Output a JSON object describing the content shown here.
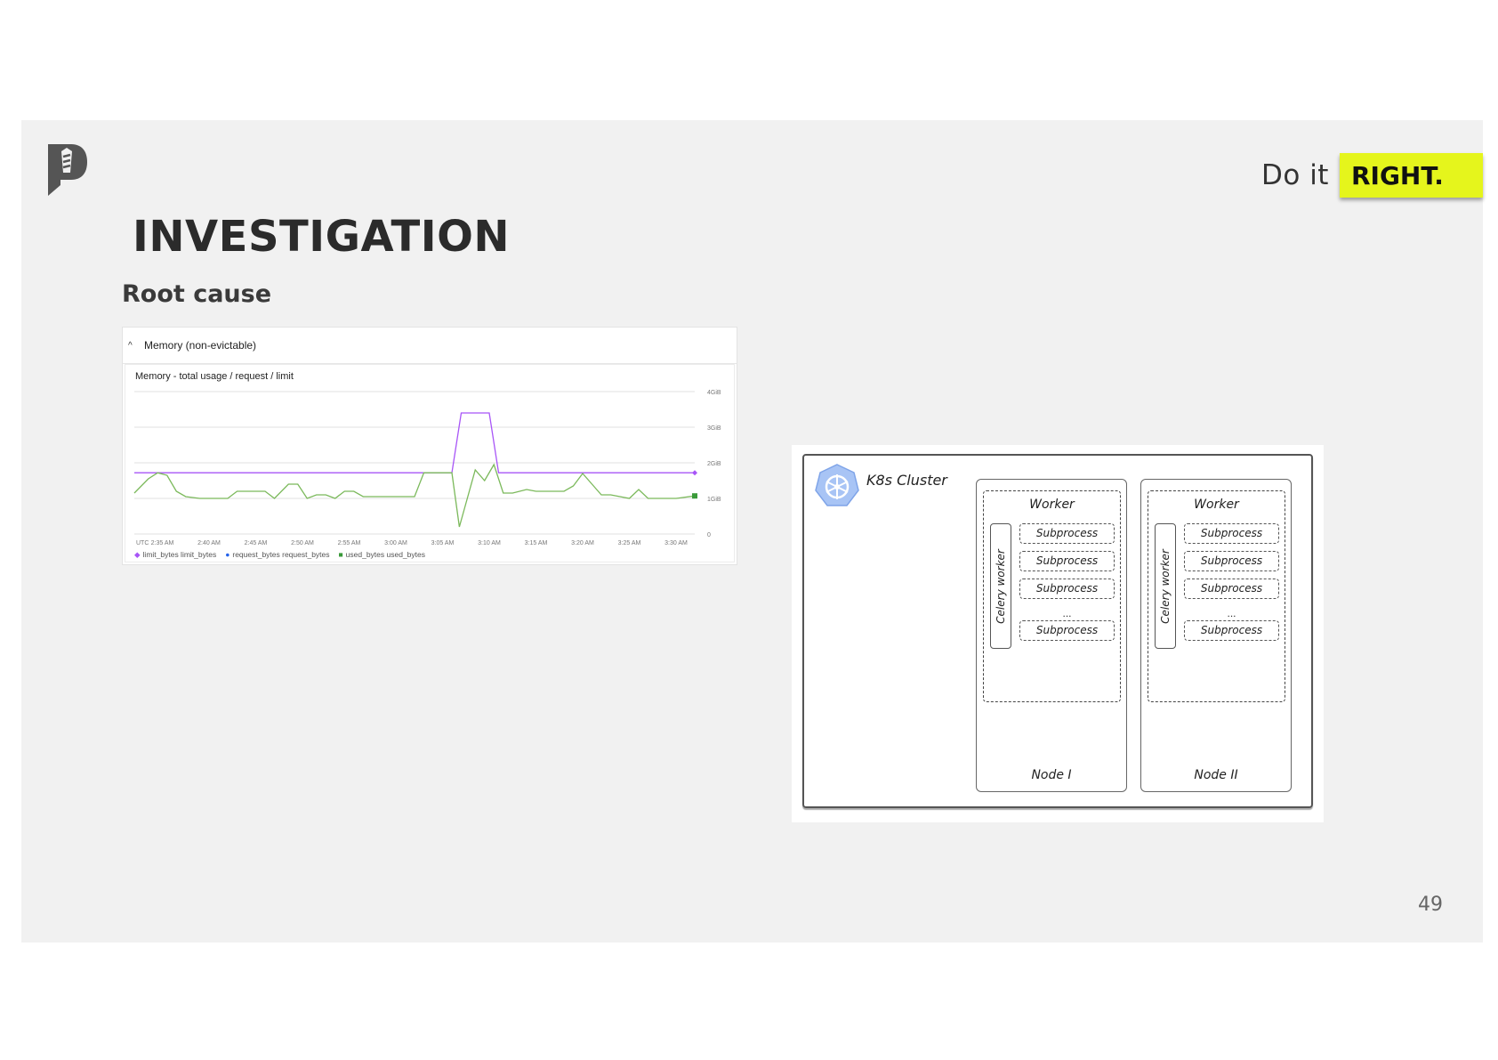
{
  "slide": {
    "tagline_prefix": "Do it",
    "tagline_badge": "RIGHT.",
    "title": "INVESTIGATION",
    "subtitle": "Root cause",
    "page_number": "49",
    "accent_color": "#e5f51c"
  },
  "chart_panel": {
    "header": "Memory (non-evictable)",
    "chart_title": "Memory - total usage / request / limit",
    "x_ticks": [
      "UTC",
      "2:35 AM",
      "2:40 AM",
      "2:45 AM",
      "2:50 AM",
      "2:55 AM",
      "3:00 AM",
      "3:05 AM",
      "3:10 AM",
      "3:15 AM",
      "3:20 AM",
      "3:25 AM",
      "3:30 AM"
    ],
    "y_ticks": [
      "4GiB",
      "3GiB",
      "2GiB",
      "1GiB",
      "0"
    ],
    "legend": [
      {
        "label": "limit_bytes limit_bytes",
        "color": "#a855f7",
        "marker": "◆"
      },
      {
        "label": "request_bytes request_bytes",
        "color": "#2563eb",
        "marker": "●"
      },
      {
        "label": "used_bytes used_bytes",
        "color": "#3a9a3a",
        "marker": "■"
      }
    ]
  },
  "chart_data": {
    "type": "line",
    "title": "Memory - total usage / request / limit",
    "ylim": [
      0,
      4
    ],
    "x_range": [
      "2:32 AM",
      "3:32 AM"
    ],
    "series": [
      {
        "name": "limit_bytes limit_bytes",
        "color": "#a855f7",
        "points": [
          [
            0,
            1.72
          ],
          [
            34,
            1.72
          ],
          [
            35,
            3.4
          ],
          [
            38,
            3.4
          ],
          [
            39,
            1.72
          ],
          [
            60,
            1.72
          ]
        ]
      },
      {
        "name": "used_bytes used_bytes",
        "color": "#7bb95b",
        "points": [
          [
            0,
            1.15
          ],
          [
            1.5,
            1.55
          ],
          [
            2.5,
            1.72
          ],
          [
            3.5,
            1.65
          ],
          [
            4.5,
            1.2
          ],
          [
            5.5,
            1.05
          ],
          [
            7,
            1.0
          ],
          [
            10,
            1.0
          ],
          [
            11,
            1.2
          ],
          [
            14,
            1.2
          ],
          [
            15,
            1.0
          ],
          [
            16.5,
            1.4
          ],
          [
            17.5,
            1.4
          ],
          [
            18.5,
            1.0
          ],
          [
            19.5,
            1.1
          ],
          [
            20.5,
            1.1
          ],
          [
            21.5,
            1.0
          ],
          [
            22.5,
            1.2
          ],
          [
            23.5,
            1.2
          ],
          [
            24.5,
            1.05
          ],
          [
            30,
            1.05
          ],
          [
            31,
            1.72
          ],
          [
            34,
            1.72
          ],
          [
            34.8,
            0.2
          ],
          [
            36.5,
            1.8
          ],
          [
            37.5,
            1.5
          ],
          [
            38.5,
            1.95
          ],
          [
            39.5,
            1.15
          ],
          [
            40.5,
            1.15
          ],
          [
            42,
            1.25
          ],
          [
            43,
            1.2
          ],
          [
            46,
            1.2
          ],
          [
            47,
            1.35
          ],
          [
            48,
            1.7
          ],
          [
            49,
            1.4
          ],
          [
            50,
            1.1
          ],
          [
            51,
            1.1
          ],
          [
            52,
            1.05
          ],
          [
            53,
            1.0
          ],
          [
            54,
            1.25
          ],
          [
            55,
            1.0
          ],
          [
            58,
            1.0
          ],
          [
            60,
            1.07
          ]
        ]
      }
    ]
  },
  "diagram": {
    "cluster_label": "K8s Cluster",
    "nodes": [
      {
        "worker_label": "Worker",
        "celery_label": "Celery worker",
        "subprocesses": [
          "Subprocess",
          "Subprocess",
          "Subprocess",
          "Subprocess"
        ],
        "ellipsis": "...",
        "node_label": "Node I"
      },
      {
        "worker_label": "Worker",
        "celery_label": "Celery worker",
        "subprocesses": [
          "Subprocess",
          "Subprocess",
          "Subprocess",
          "Subprocess"
        ],
        "ellipsis": "...",
        "node_label": "Node II"
      }
    ]
  }
}
